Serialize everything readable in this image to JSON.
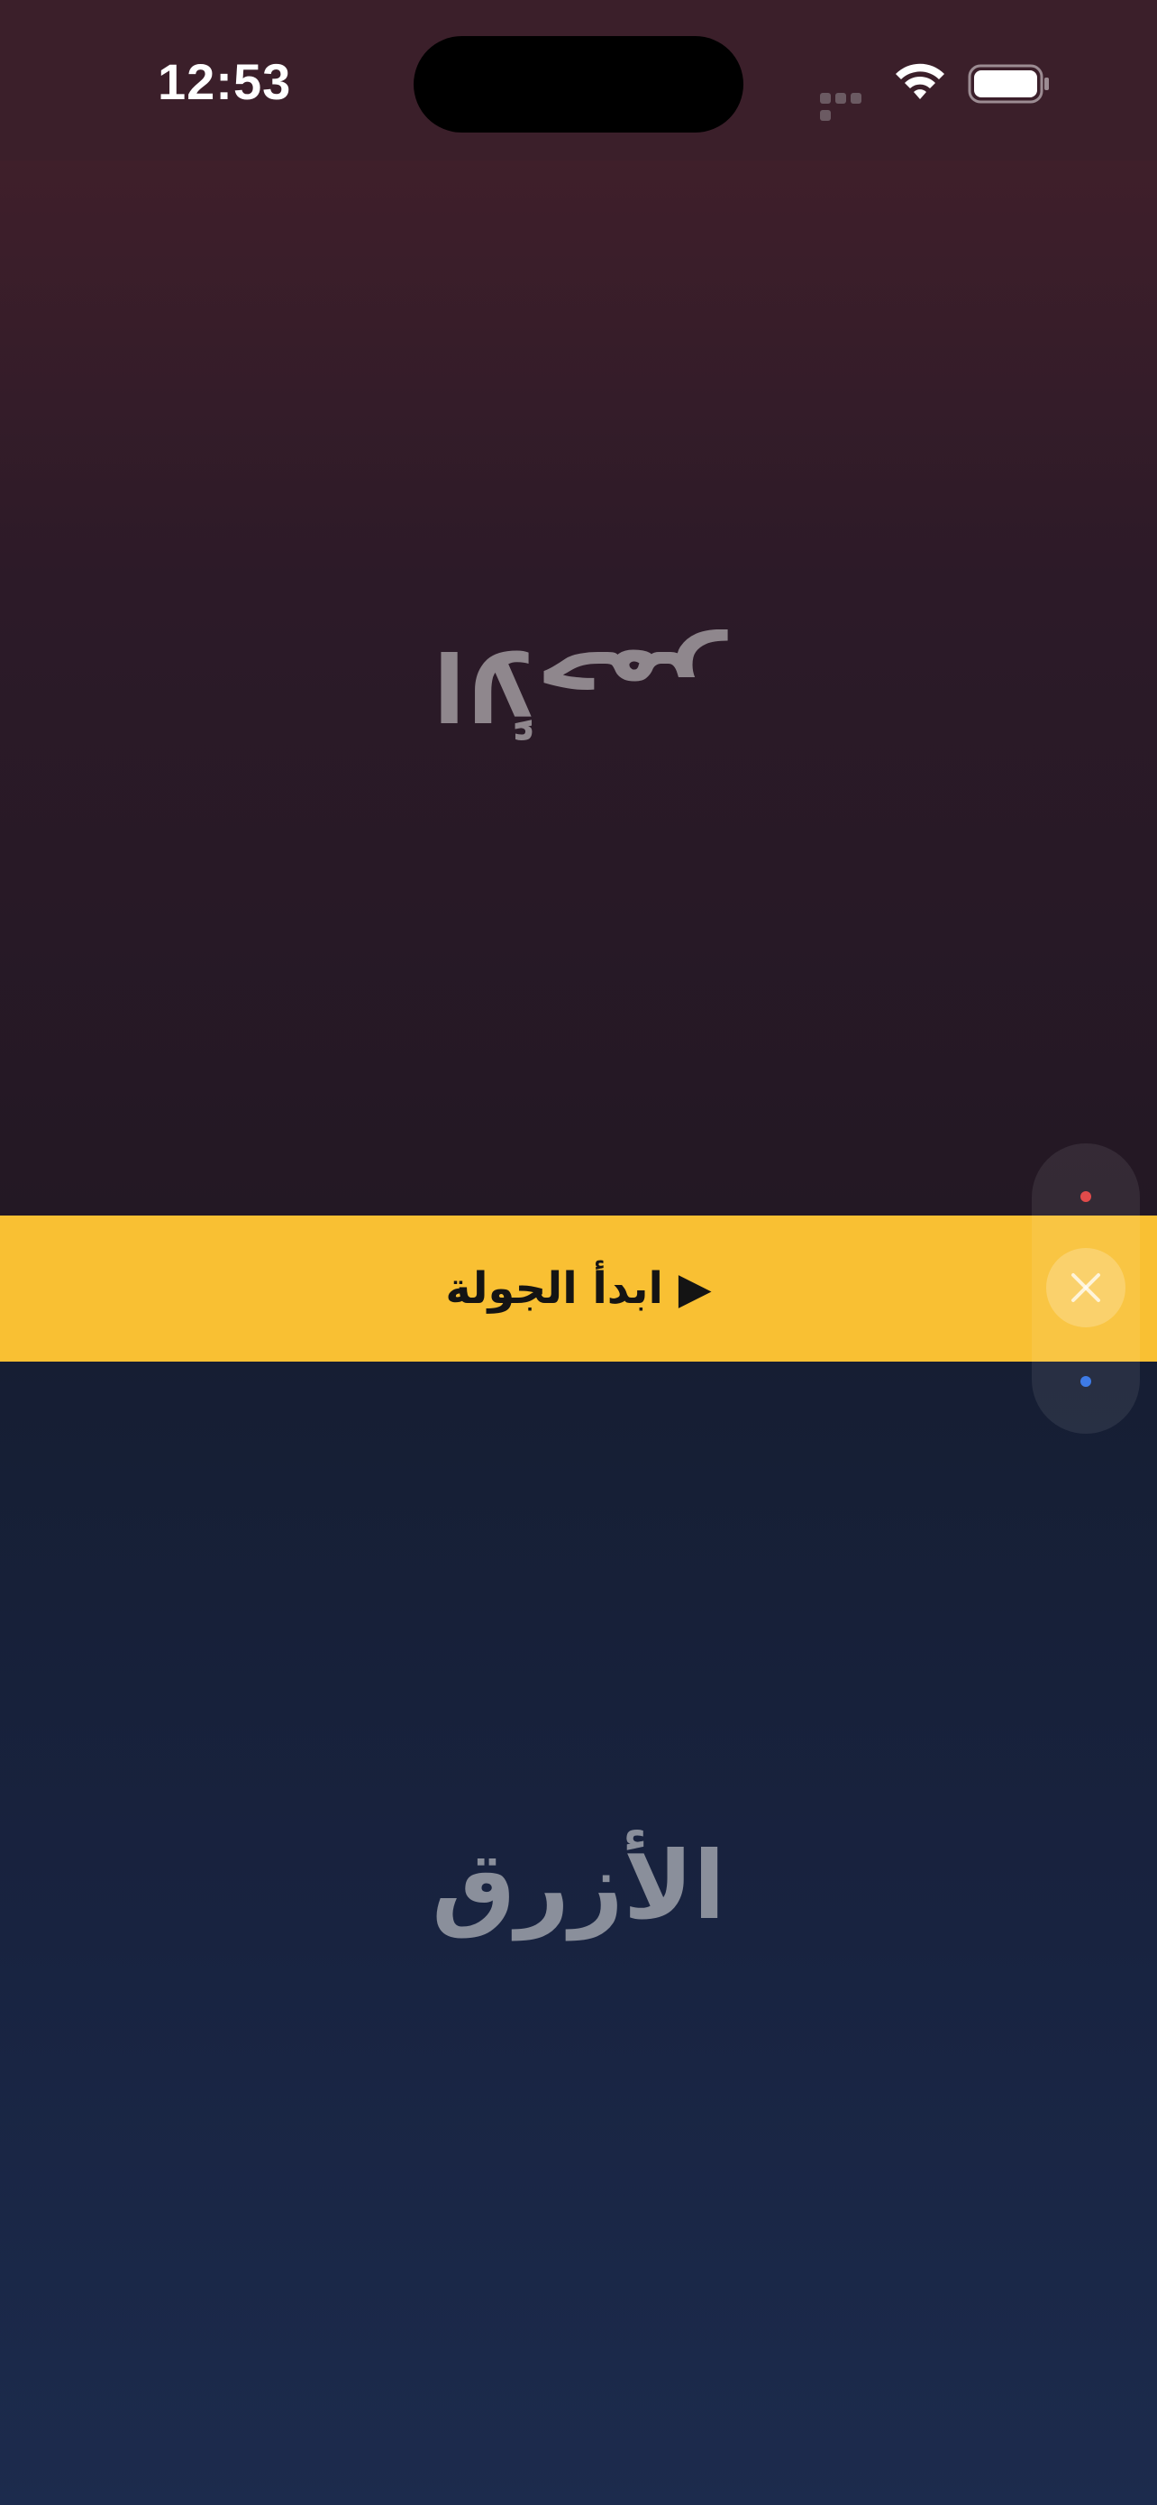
{
  "status_bar": {
    "time": "12:53",
    "icons": [
      "signal-icon",
      "wifi-icon",
      "battery-icon"
    ]
  },
  "teams": {
    "red": {
      "label": "الأحمر",
      "color": "#e24b4b"
    },
    "blue": {
      "label": "الأزرق",
      "color": "#3e7be6"
    }
  },
  "start_button": {
    "label": "▶ ابدأ الجولة"
  },
  "controls": {
    "close_icon": "close-icon"
  },
  "colors": {
    "banner": "#f9c033",
    "red_team_bg": "#3f1f2a",
    "blue_team_bg": "#182340"
  }
}
